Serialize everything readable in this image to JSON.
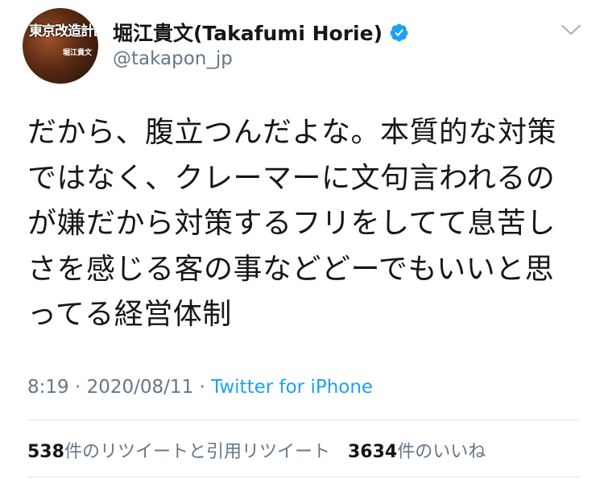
{
  "user": {
    "display_name": "堀江貴文(Takafumi Horie)",
    "handle": "@takapon_jp",
    "avatar_text": "東京改造計画",
    "avatar_subtext": "堀江貴文"
  },
  "tweet": {
    "lines": [
      "だから、腹立つんだよな。本質的な対策",
      "ではなく、クレーマーに文句言われるの",
      "が嫌だから対策するフリをしてて息苦し",
      "さを感じる客の事などどーでもいいと思",
      "ってる経営体制"
    ]
  },
  "meta": {
    "time": "8:19",
    "separator": "·",
    "date": "2020/08/11",
    "separator2": "·",
    "source": "Twitter for iPhone"
  },
  "stats": {
    "retweets_count": "538",
    "retweets_label": "件のリツイートと引用リツイート",
    "likes_count": "3634",
    "likes_label": "件のいいね"
  },
  "icons": {
    "verified": "verified-badge-icon",
    "more": "chevron-down-icon"
  },
  "colors": {
    "link": "#1da1f2",
    "secondary": "#657786",
    "text": "#14171a",
    "divider": "#e1e8ed"
  }
}
